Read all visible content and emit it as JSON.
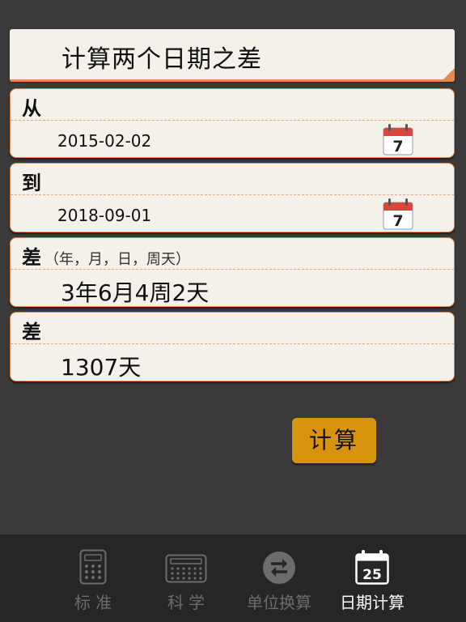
{
  "header": {
    "title": "计算两个日期之差"
  },
  "from": {
    "label": "从",
    "date": "2015-02-02",
    "icon": "calendar-icon",
    "icon_number": "7"
  },
  "to": {
    "label": "到",
    "date": "2018-09-01",
    "icon": "calendar-icon",
    "icon_number": "7"
  },
  "diff_ymd": {
    "label": "差",
    "sublabel": "（年，月，日，周天）",
    "value": "3年6月4周2天"
  },
  "diff_days": {
    "label": "差",
    "value": "1307天"
  },
  "calculate_button": {
    "label": "计算"
  },
  "tabs": [
    {
      "label": "标 准",
      "icon": "calculator-icon",
      "active": false
    },
    {
      "label": "科 学",
      "icon": "keyboard-icon",
      "active": false
    },
    {
      "label": "单位换算",
      "icon": "swap-icon",
      "active": false
    },
    {
      "label": "日期计算",
      "icon": "calendar-icon",
      "icon_number": "25",
      "active": true
    }
  ],
  "colors": {
    "background": "#3a3a3a",
    "card": "#f4f1ea",
    "accent": "#e9884c",
    "button": "#d9940e",
    "tabbar": "#262626",
    "calendar_red": "#d9463c"
  }
}
